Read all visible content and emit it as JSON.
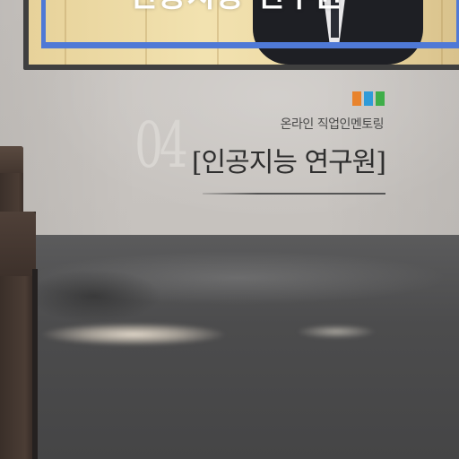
{
  "screen": {
    "title": "인공지능 연구원"
  },
  "caption": {
    "number": "04",
    "subtitle": "온라인 직업인멘토링",
    "title": "[인공지능 연구원]",
    "color_blocks": [
      "#e8832c",
      "#2f9bd8",
      "#3fae49"
    ]
  },
  "colors": {
    "screen_frame": "#4f79d6",
    "wall": "#c8c4c0",
    "floor": "#4c4c4d",
    "podium": "#43362f"
  }
}
